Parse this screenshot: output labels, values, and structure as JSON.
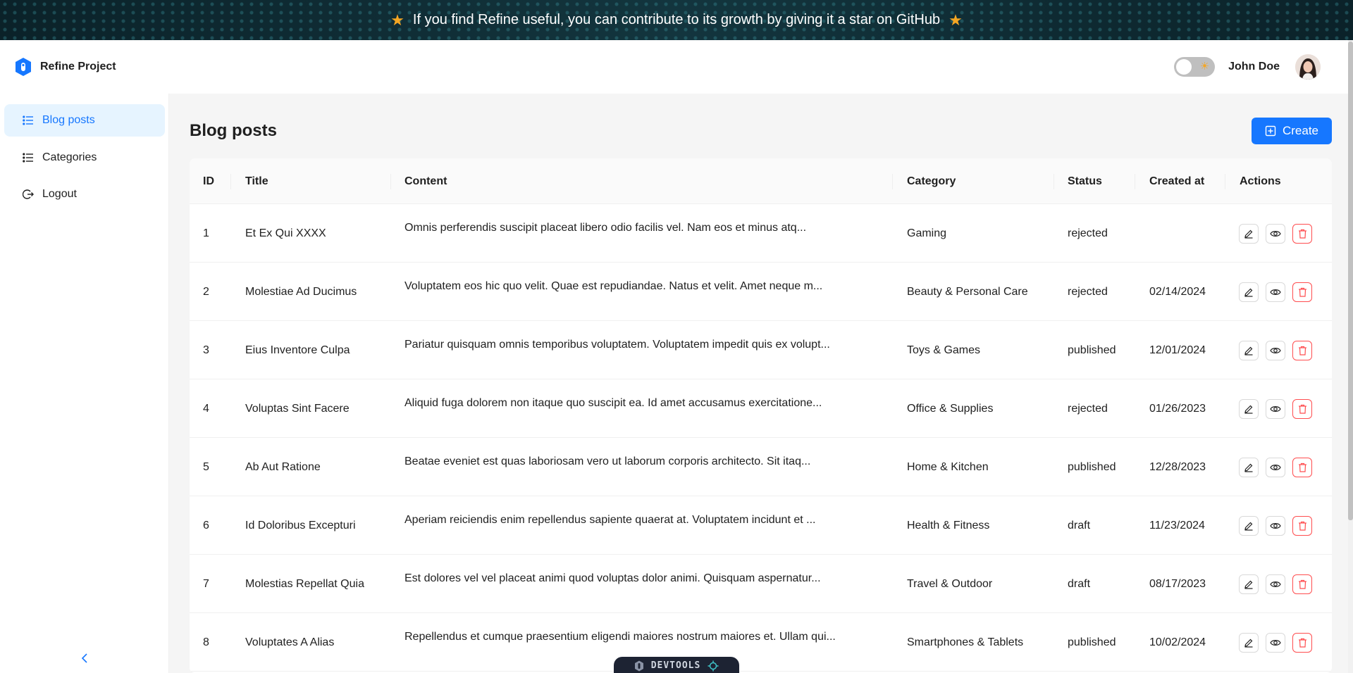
{
  "banner": {
    "text": "If you find Refine useful, you can contribute to its growth by giving it a star on GitHub",
    "star_color": "#f5a623"
  },
  "header": {
    "brand_title": "Refine Project",
    "user_name": "John Doe",
    "theme_toggle_icon": "sun-icon"
  },
  "sidebar": {
    "items": [
      {
        "label": "Blog posts",
        "icon": "list-icon",
        "active": true
      },
      {
        "label": "Categories",
        "icon": "list-icon",
        "active": false
      },
      {
        "label": "Logout",
        "icon": "logout-icon",
        "active": false
      }
    ],
    "collapse_icon": "chevron-left-icon"
  },
  "page": {
    "title": "Blog posts",
    "create_label": "Create",
    "accent_color": "#1677ff",
    "danger_color": "#ff4d4f"
  },
  "table": {
    "columns": [
      "ID",
      "Title",
      "Content",
      "Category",
      "Status",
      "Created at",
      "Actions"
    ],
    "rows": [
      {
        "id": "1",
        "title": "Et Ex Qui XXXX",
        "content": "Omnis perferendis suscipit placeat libero odio facilis vel. Nam eos et minus atq...",
        "category": "Gaming",
        "status": "rejected",
        "created_at": ""
      },
      {
        "id": "2",
        "title": "Molestiae Ad Ducimus",
        "content": "Voluptatem eos hic quo velit. Quae est repudiandae. Natus et velit. Amet neque m...",
        "category": "Beauty & Personal Care",
        "status": "rejected",
        "created_at": "02/14/2024"
      },
      {
        "id": "3",
        "title": "Eius Inventore Culpa",
        "content": "Pariatur quisquam omnis temporibus voluptatem. Voluptatem impedit quis ex volupt...",
        "category": "Toys & Games",
        "status": "published",
        "created_at": "12/01/2024"
      },
      {
        "id": "4",
        "title": "Voluptas Sint Facere",
        "content": "Aliquid fuga dolorem non itaque quo suscipit ea. Id amet accusamus exercitatione...",
        "category": "Office & Supplies",
        "status": "rejected",
        "created_at": "01/26/2023"
      },
      {
        "id": "5",
        "title": "Ab Aut Ratione",
        "content": "Beatae eveniet est quas laboriosam vero ut laborum corporis architecto. Sit itaq...",
        "category": "Home & Kitchen",
        "status": "published",
        "created_at": "12/28/2023"
      },
      {
        "id": "6",
        "title": "Id Doloribus Excepturi",
        "content": "Aperiam reiciendis enim repellendus sapiente quaerat at. Voluptatem incidunt et ...",
        "category": "Health & Fitness",
        "status": "draft",
        "created_at": "11/23/2024"
      },
      {
        "id": "7",
        "title": "Molestias Repellat Quia",
        "content": "Est dolores vel vel placeat animi quod voluptas dolor animi. Quisquam aspernatur...",
        "category": "Travel & Outdoor",
        "status": "draft",
        "created_at": "08/17/2023"
      },
      {
        "id": "8",
        "title": "Voluptates A Alias",
        "content": "Repellendus et cumque praesentium eligendi maiores nostrum maiores et. Ullam qui...",
        "category": "Smartphones & Tablets",
        "status": "published",
        "created_at": "10/02/2024"
      }
    ],
    "action_icons": [
      "edit-icon",
      "eye-icon",
      "trash-icon"
    ]
  },
  "devtools": {
    "label": "DEVTOOLS"
  }
}
